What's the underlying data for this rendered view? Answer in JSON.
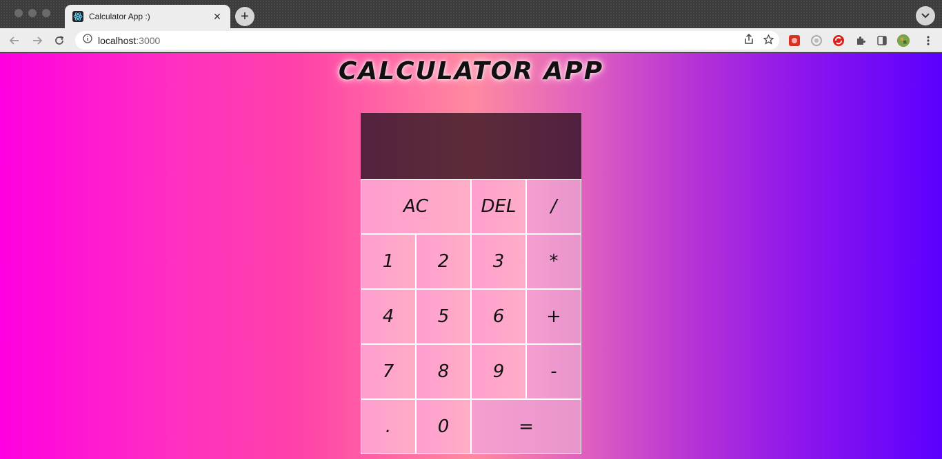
{
  "browser": {
    "tab": {
      "title": "Calculator App :)"
    },
    "new_tab_label": "+",
    "address_bar": {
      "host": "localhost",
      "port": ":3000"
    }
  },
  "page": {
    "title": "CALCULATOR APP",
    "display": {
      "previous_operand": "",
      "current_operand": ""
    },
    "buttons": {
      "ac": "AC",
      "del": "DEL",
      "divide": "/",
      "one": "1",
      "two": "2",
      "three": "3",
      "multiply": "*",
      "four": "4",
      "five": "5",
      "six": "6",
      "add": "+",
      "seven": "7",
      "eight": "8",
      "nine": "9",
      "subtract": "-",
      "decimal": ".",
      "zero": "0",
      "equals": "="
    }
  }
}
